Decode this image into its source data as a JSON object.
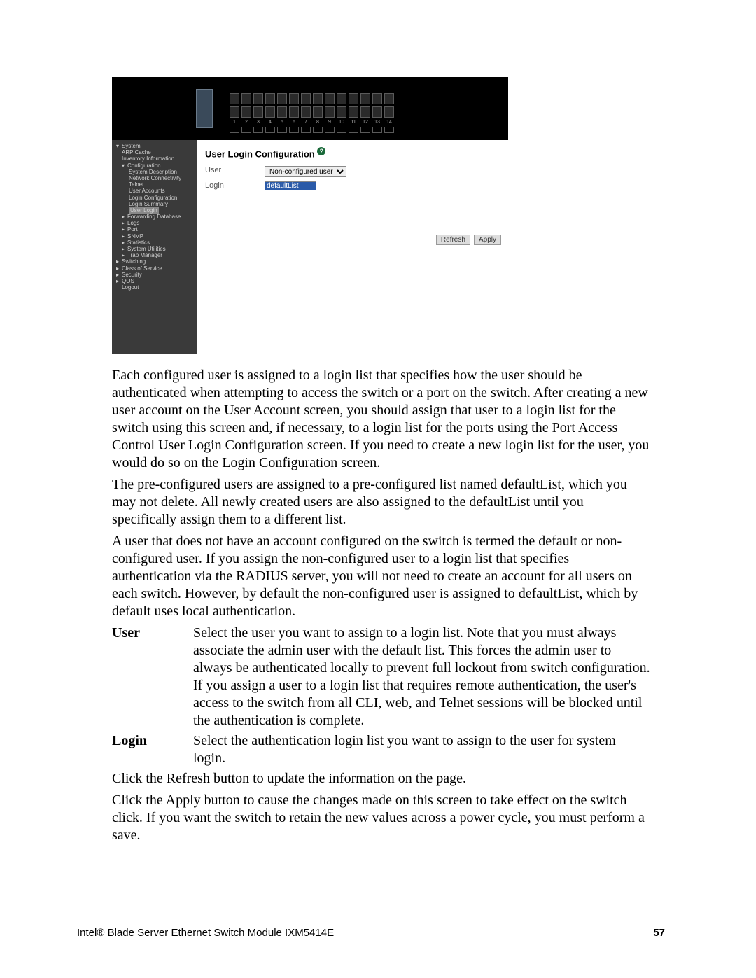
{
  "screenshot": {
    "port_numbers": [
      "1",
      "2",
      "3",
      "4",
      "5",
      "6",
      "7",
      "8",
      "9",
      "10",
      "11",
      "12",
      "13",
      "14"
    ],
    "nav": [
      {
        "label": "System",
        "indent": 0,
        "arrow": "▾"
      },
      {
        "label": "ARP Cache",
        "indent": 1
      },
      {
        "label": "Inventory Information",
        "indent": 1
      },
      {
        "label": "Configuration",
        "indent": 1,
        "arrow": "▾"
      },
      {
        "label": "System Description",
        "indent": 2
      },
      {
        "label": "Network Connectivity",
        "indent": 2
      },
      {
        "label": "Telnet",
        "indent": 2
      },
      {
        "label": "User Accounts",
        "indent": 2
      },
      {
        "label": "Login Configuration",
        "indent": 2
      },
      {
        "label": "Login Summary",
        "indent": 2
      },
      {
        "label": "User Login",
        "indent": 2,
        "active": true
      },
      {
        "label": "Forwarding Database",
        "indent": 1,
        "arrow": "▸"
      },
      {
        "label": "Logs",
        "indent": 1,
        "arrow": "▸"
      },
      {
        "label": "Port",
        "indent": 1,
        "arrow": "▸"
      },
      {
        "label": "SNMP",
        "indent": 1,
        "arrow": "▸"
      },
      {
        "label": "Statistics",
        "indent": 1,
        "arrow": "▸"
      },
      {
        "label": "System Utilities",
        "indent": 1,
        "arrow": "▸"
      },
      {
        "label": "Trap Manager",
        "indent": 1,
        "arrow": "▸"
      },
      {
        "label": "Switching",
        "indent": 0,
        "arrow": "▸"
      },
      {
        "label": "Class of Service",
        "indent": 0,
        "arrow": "▸"
      },
      {
        "label": "Security",
        "indent": 0,
        "arrow": "▸"
      },
      {
        "label": "QOS",
        "indent": 0,
        "arrow": "▸"
      },
      {
        "label": "Logout",
        "indent": 1
      }
    ],
    "panel_title": "User Login Configuration",
    "help_symbol": "?",
    "form": {
      "user_label": "User",
      "user_value": "Non-configured user",
      "login_label": "Login",
      "login_value": "defaultList"
    },
    "buttons": {
      "refresh": "Refresh",
      "apply": "Apply"
    }
  },
  "body": {
    "p1": "Each configured user is assigned to a login list that specifies how the user should be authenticated when attempting to access the switch or a port on the switch. After creating a new user account on the User Account screen, you should assign that user to a login list for the switch using this screen and, if necessary, to a login list for the ports using the Port Access Control User Login Configuration screen. If you need to create a new login list for the user, you would do so on the Login Configuration screen.",
    "p2": "The pre-configured users are assigned to a pre-configured list named defaultList, which you may not delete. All newly created users are also assigned to the defaultList until you specifically assign them to a different list.",
    "p3": "A user that does not have an account configured on the switch is termed the default or non-configured user. If you assign the non-configured user to a login list that specifies authentication via the RADIUS server, you will not need to create an account for all users on each switch. However, by default the non-configured user is assigned to defaultList, which by default uses local authentication.",
    "def_user_term": "User",
    "def_user_desc": "Select the user you want to assign to a login list. Note that you must always associate the admin user with the default list. This forces the admin user to always be authenticated locally to prevent full lockout from switch configuration. If you assign a user to a login list that requires remote authentication, the user's access to the switch from all CLI, web, and Telnet sessions will be blocked until the authentication is complete.",
    "def_login_term": "Login",
    "def_login_desc": "Select the authentication login list you want to assign to the user for system login.",
    "p4": "Click the Refresh button to update the information on the page.",
    "p5": "Click the Apply button to cause the changes made on this screen to take effect on the switch click. If you want the switch to retain the new values across a power cycle, you must perform a save."
  },
  "footer": {
    "left": "Intel® Blade Server Ethernet Switch Module IXM5414E",
    "right": "57"
  }
}
